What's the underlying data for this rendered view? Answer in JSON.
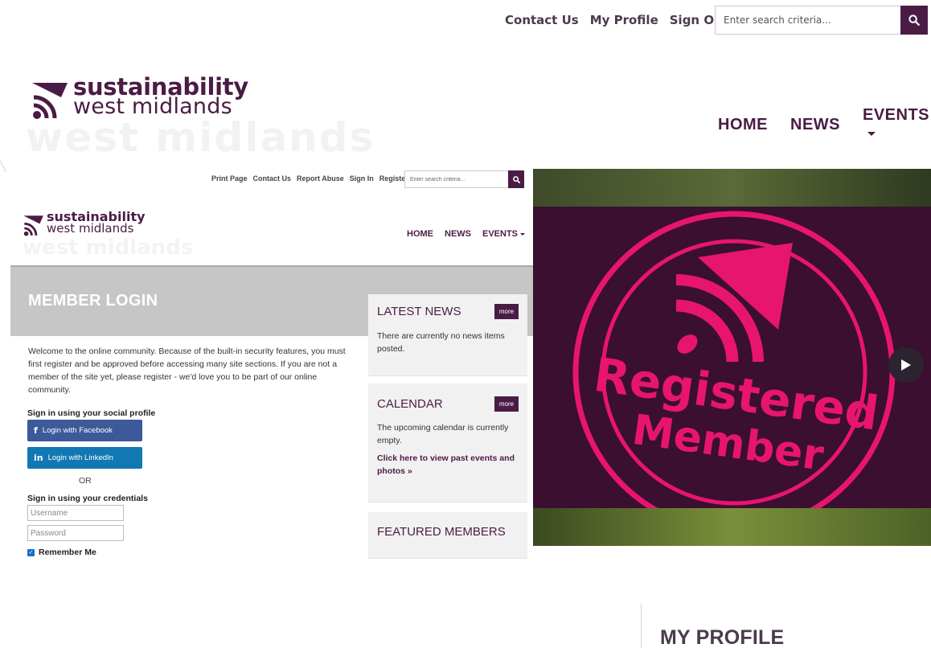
{
  "top_bar": {
    "links": [
      "Contact Us",
      "My Profile",
      "Sign Out"
    ],
    "search_placeholder": "Enter search criteria...",
    "search_icon": "search-icon"
  },
  "brand": {
    "line1": "sustainability",
    "line2": "west midlands",
    "color": "#4a1c45"
  },
  "main_nav": {
    "home": "HOME",
    "news": "NEWS",
    "events": "EVENTS"
  },
  "embedded": {
    "utility_links": [
      "Print Page",
      "Contact Us",
      "Report Abuse",
      "Sign In",
      "Register"
    ],
    "search_placeholder": "Enter search criteria...",
    "nav": {
      "home": "HOME",
      "news": "NEWS",
      "events": "EVENTS"
    },
    "page_title": "MEMBER LOGIN",
    "intro": "Welcome to the online community. Because of the built-in security features, you must first register and be approved before accessing many site sections. If you are not a member of the site yet, please register - we'd love you to be part of our online community.",
    "social_heading": "Sign in using your social profile",
    "facebook_label": "Login with Facebook",
    "linkedin_label": "Login with LinkedIn",
    "or_label": "OR",
    "credentials_heading": "Sign in using your credentials",
    "username_placeholder": "Username",
    "password_placeholder": "Password",
    "remember_label": "Remember Me",
    "widgets": {
      "latest_news": {
        "title": "LATEST NEWS",
        "more": "more",
        "text": "There are currently no news items posted."
      },
      "calendar": {
        "title": "CALENDAR",
        "more": "more",
        "text": "The upcoming calendar is currently empty.",
        "link": "Click here to view past events and photos »"
      },
      "featured": {
        "title": "FEATURED MEMBERS"
      }
    }
  },
  "hero_image": {
    "badge_line1": "Registered",
    "badge_line2": "Member",
    "accent": "#e8156f",
    "background": "#3a0f30"
  },
  "footer": {
    "my_profile_title": "MY PROFILE"
  }
}
